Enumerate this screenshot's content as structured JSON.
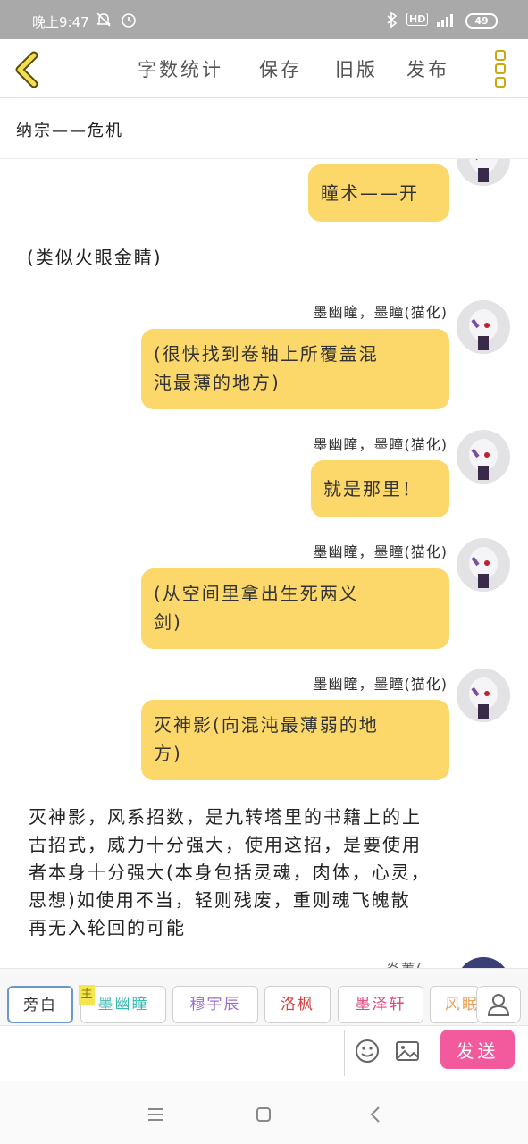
{
  "status_bar": {
    "time": "晚上9:47",
    "network": "HD",
    "battery": "49"
  },
  "header": {
    "word_count_label": "字数统计",
    "save_label": "保存",
    "old_version_label": "旧版",
    "publish_label": "发布"
  },
  "chapter_title": "纳宗——危机",
  "messages": {
    "m1": "瞳术——开",
    "n1": "(类似火眼金睛)",
    "m2_sender": "墨幽瞳，墨瞳(猫化)",
    "m2_line1": "(很快找到卷轴上所覆盖混",
    "m2_line2": "沌最薄的地方)",
    "m3_sender": "墨幽瞳，墨瞳(猫化)",
    "m3": "就是那里！",
    "m4_sender": "墨幽瞳，墨瞳(猫化)",
    "m4_line1": "(从空间里拿出生死两义",
    "m4_line2": "剑)",
    "m5_sender": "墨幽瞳，墨瞳(猫化)",
    "m5_line1": "灭神影(向混沌最薄弱的地",
    "m5_line2": "方)",
    "n2_line1": "灭神影，风系招数，是九转塔里的书籍上的上",
    "n2_line2": "古招式，威力十分强大，使用这招，是要使用",
    "n2_line3": "者本身十分强大(本身包括灵魂，肉体，心灵，",
    "n2_line4": "思想)如使用不当，轻则残废，重则魂飞魄散",
    "n2_line5": "再无入轮回的可能",
    "m6_sender_partial": "炎菁(..."
  },
  "roles": {
    "narration": "旁白",
    "main_tag": "主",
    "r1": "墨幽瞳",
    "r2": "穆宇辰",
    "r3": "洛枫",
    "r4": "墨泽轩",
    "r5": "风眠"
  },
  "role_colors": {
    "r1": "#3bb8b0",
    "r2": "#9b6fc8",
    "r3": "#d24040",
    "r4": "#e0457f",
    "r5": "#e9a15a"
  },
  "input": {
    "placeholder": "",
    "send_label": "发送"
  },
  "colors": {
    "bubble": "#fcd86b",
    "send": "#f25a9d",
    "accent": "#c8aa10"
  },
  "icons": [
    "back-arrow-icon",
    "more-menu-icon",
    "emoji-icon",
    "image-icon",
    "profile-icon",
    "nav-menu-icon",
    "nav-home-icon",
    "nav-back-icon"
  ]
}
